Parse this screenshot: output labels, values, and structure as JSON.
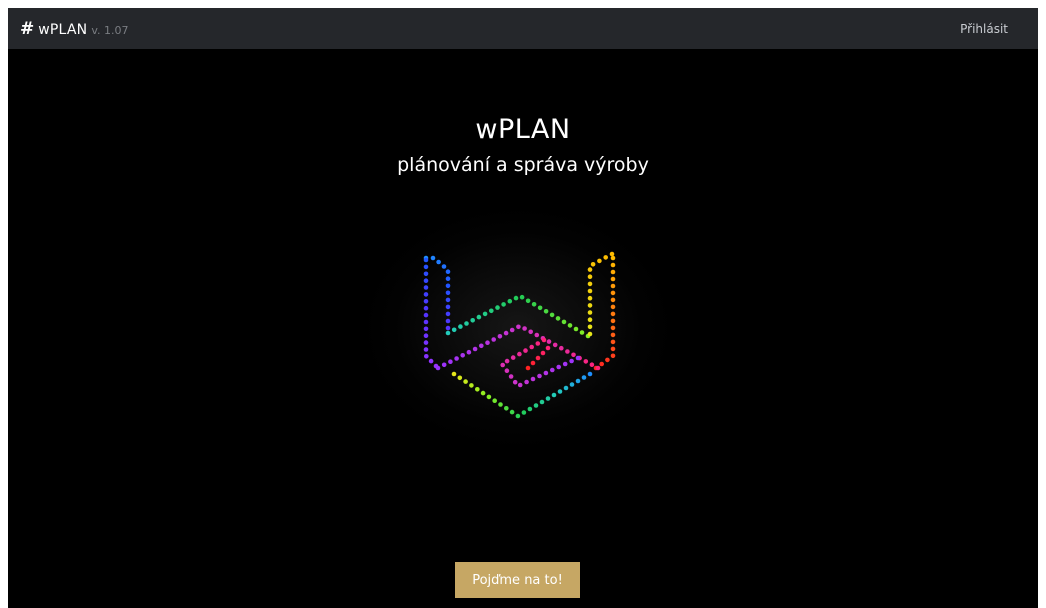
{
  "navbar": {
    "brand_icon": "#",
    "brand_name": "wPLAN",
    "version": "v. 1.07",
    "login_label": "Přihlásit"
  },
  "hero": {
    "title": "wPLAN",
    "subtitle": "plánování a správa výroby"
  },
  "logo": {
    "icon": "rainbow-dotted-wplan-logo-icon",
    "colors": [
      "#1f8fff",
      "#2255ff",
      "#5533ff",
      "#9933ff",
      "#cc33cc",
      "#ff2277",
      "#ff2222",
      "#ff7711",
      "#ffbb00",
      "#e6e61a",
      "#88ee22",
      "#22cc55",
      "#22ccbb"
    ]
  },
  "cta": {
    "label": "Pojďme na to!"
  },
  "colors": {
    "navbar_bg": "#25272b",
    "page_bg": "#000000",
    "cta_bg": "#c6a764"
  }
}
